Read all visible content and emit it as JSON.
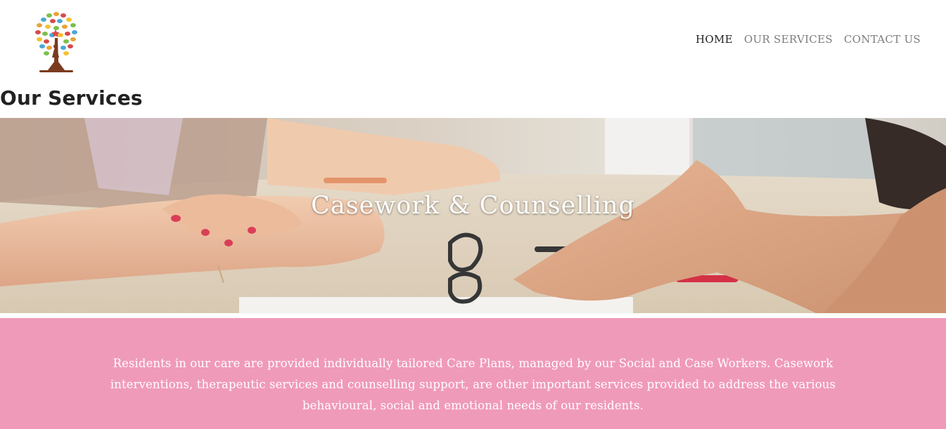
{
  "header": {
    "logo_icon": "tree-girl-logo-icon",
    "nav": [
      {
        "label": "HOME",
        "active": true
      },
      {
        "label": "OUR SERVICES",
        "active": false
      },
      {
        "label": "CONTACT US",
        "active": false
      }
    ]
  },
  "page": {
    "title": "Our Services"
  },
  "hero": {
    "title": "Casework & Counselling",
    "image_subject": "two-hands-on-table-photo"
  },
  "info": {
    "text": "Residents in our care are provided individually tailored Care Plans, managed by our Social and Case Workers. Casework interventions, therapeutic services and counselling support, are other important services provided to address the various behavioural, social and emotional needs of our residents."
  },
  "colors": {
    "accent_pink": "#f09ab9",
    "nav_active": "#222222",
    "nav_inactive": "#7d7d7d"
  }
}
